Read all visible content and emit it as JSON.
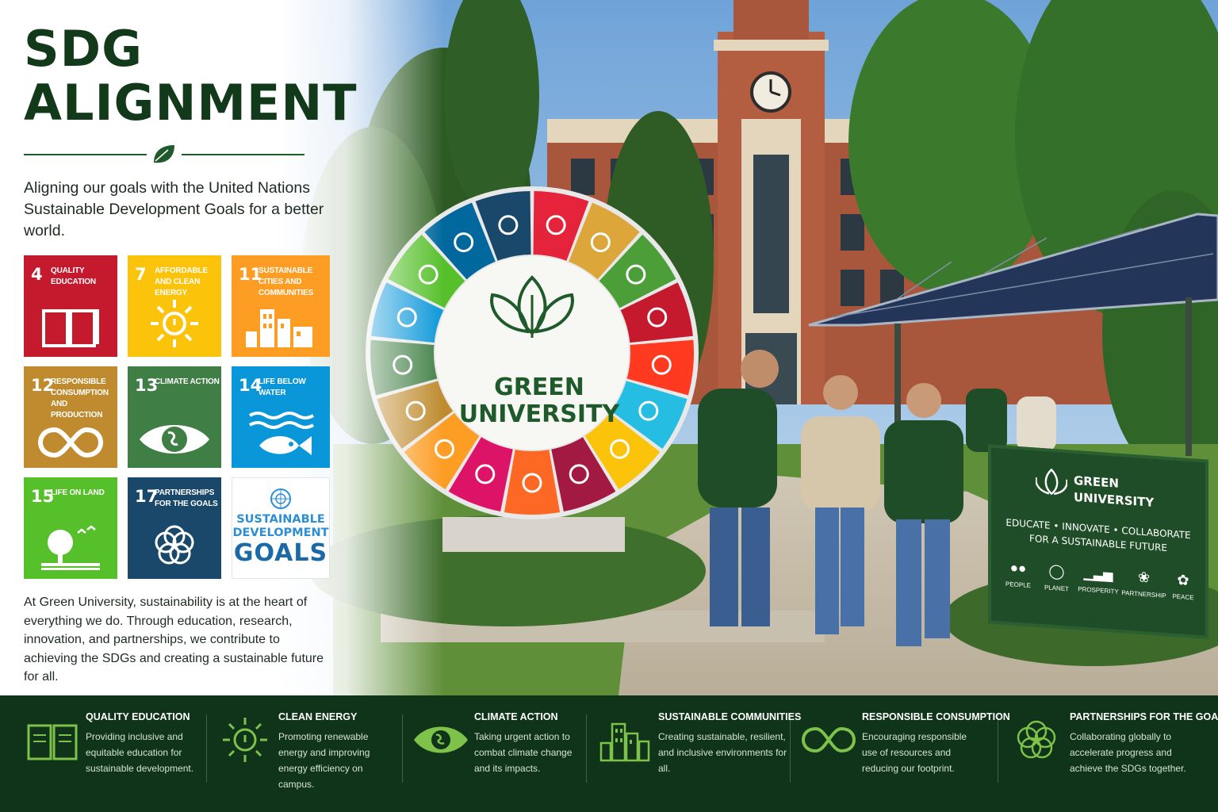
{
  "header": {
    "title_line1": "SDG",
    "title_line2": "ALIGNMENT",
    "subtitle": "Aligning our goals with the United Nations Sustainable Development Goals for a better world."
  },
  "goals": [
    {
      "number": "4",
      "label": "Quality Education",
      "color": "#c5192d",
      "icon": "book-icon"
    },
    {
      "number": "7",
      "label": "Affordable and Clean Energy",
      "color": "#fcc30b",
      "icon": "sun-icon"
    },
    {
      "number": "11",
      "label": "Sustainable Cities and Communities",
      "color": "#fd9d24",
      "icon": "city-icon"
    },
    {
      "number": "12",
      "label": "Responsible Consumption and Production",
      "color": "#bf8b2e",
      "icon": "infinity-icon"
    },
    {
      "number": "13",
      "label": "Climate Action",
      "color": "#3f7e44",
      "icon": "eye-globe-icon"
    },
    {
      "number": "14",
      "label": "Life Below Water",
      "color": "#0a97d9",
      "icon": "fish-icon"
    },
    {
      "number": "15",
      "label": "Life on Land",
      "color": "#56c02b",
      "icon": "tree-icon"
    },
    {
      "number": "17",
      "label": "Partnerships for the Goals",
      "color": "#19486a",
      "icon": "rings-icon"
    }
  ],
  "sdg_logo": {
    "line1": "SUSTAINABLE",
    "line2": "DEVELOPMENT",
    "line3": "GOALS"
  },
  "paragraph": "At Green University, sustainability is at the heart of everything we do. Through education, research, innovation, and partnerships, we contribute to achieving the SDGs and creating a sustainable future for all.",
  "wheel": {
    "line1": "GREEN",
    "line2": "UNIVERSITY"
  },
  "campus_sign": {
    "name_line1": "GREEN",
    "name_line2": "UNIVERSITY",
    "tagline_line1": "EDUCATE • INNOVATE • COLLABORATE",
    "tagline_line2": "FOR A SUSTAINABLE FUTURE",
    "pillars": [
      "PEOPLE",
      "PLANET",
      "PROSPERITY",
      "PARTNERSHIP",
      "PEACE"
    ]
  },
  "footer": [
    {
      "title": "QUALITY EDUCATION",
      "desc": "Providing inclusive and equitable education for sustainable development.",
      "icon": "book-icon"
    },
    {
      "title": "CLEAN ENERGY",
      "desc": "Promoting renewable energy and improving energy efficiency on campus.",
      "icon": "sun-icon"
    },
    {
      "title": "CLIMATE ACTION",
      "desc": "Taking urgent action to combat climate change and its impacts.",
      "icon": "eye-globe-icon"
    },
    {
      "title": "SUSTAINABLE COMMUNITIES",
      "desc": "Creating sustainable, resilient, and inclusive environments for all.",
      "icon": "city-icon"
    },
    {
      "title": "RESPONSIBLE CONSUMPTION",
      "desc": "Encouraging responsible use of resources and reducing our footprint.",
      "icon": "infinity-icon"
    },
    {
      "title": "PARTNERSHIPS FOR THE GOALS",
      "desc": "Collaborating globally to accelerate progress and achieve the SDGs together.",
      "icon": "rings-icon"
    }
  ],
  "colors": {
    "brand_green": "#123a1a",
    "footer_bg": "#0f3419",
    "footer_icon": "#7ec24a",
    "wheel_segments": [
      "#e5243b",
      "#dda63a",
      "#4c9f38",
      "#c5192d",
      "#ff3a21",
      "#26bde2",
      "#fcc30b",
      "#a21942",
      "#fd6925",
      "#dd1367",
      "#fd9d24",
      "#bf8b2e",
      "#3f7e44",
      "#0a97d9",
      "#56c02b",
      "#00689d",
      "#19486a"
    ]
  }
}
